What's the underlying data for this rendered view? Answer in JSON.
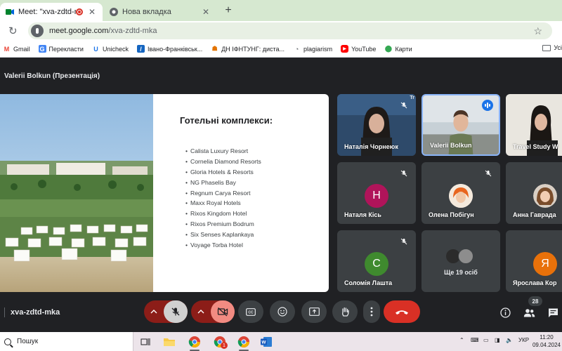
{
  "browser": {
    "tabs": [
      {
        "title": "Meet: \"xva-zdtd-mka\"",
        "active": true
      },
      {
        "title": "Нова вкладка",
        "active": false
      }
    ],
    "url_host": "meet.google.com",
    "url_path": "/xva-zdtd-mka",
    "bookmarks": [
      {
        "label": "Gmail",
        "icon": "gmail-icon"
      },
      {
        "label": "Перекласти",
        "icon": "translate-icon"
      },
      {
        "label": "Unicheck",
        "icon": "unicheck-icon"
      },
      {
        "label": "Івано-Франківськ...",
        "icon": "bookmark-site-icon"
      },
      {
        "label": "ДН ІФНТУНГ: диста...",
        "icon": "bookmark-site-icon"
      },
      {
        "label": "plagiarism",
        "icon": "plagiarism-icon"
      },
      {
        "label": "YouTube",
        "icon": "youtube-icon"
      },
      {
        "label": "Карти",
        "icon": "maps-icon"
      }
    ],
    "other_bookmarks_label": "Усі"
  },
  "meet": {
    "presenter_title": "Valerii Bolkun (Презентація)",
    "slide": {
      "title": "Готельні комплекси:",
      "hotels": [
        "Calista Luxury Resort",
        "Cornelia Diamond Resorts",
        "Gloria Hotels & Resorts",
        "NG Phaselis Bay",
        "Regnum Carya Resort",
        "Maxx Royal Hotels",
        "Rixos Kingdom Hotel",
        "Rixos Premium Bodrum",
        "Six Senses Kaplankaya",
        "Voyage Torba Hotel"
      ]
    },
    "participants": [
      {
        "name": "Наталія Чорнеюк",
        "type": "video",
        "muted": true
      },
      {
        "name": "Valerii Bolkun",
        "type": "video",
        "speaking": true
      },
      {
        "name": "Travel Study W",
        "type": "video",
        "muted": false
      },
      {
        "name": "Наталя Кісь",
        "type": "avatar",
        "initial": "Н",
        "color": "#b0145a",
        "muted": true
      },
      {
        "name": "Олена Побігун",
        "type": "photo",
        "muted": true
      },
      {
        "name": "Анна Гаврада",
        "type": "photo",
        "muted": false
      },
      {
        "name": "Соломія Лашта",
        "type": "avatar",
        "initial": "С",
        "color": "#3f8a2e",
        "muted": true
      },
      {
        "name": "Ще 19 осіб",
        "type": "more"
      },
      {
        "name": "Ярослава Кор",
        "type": "avatar",
        "initial": "Я",
        "color": "#e8710a",
        "muted": false
      }
    ],
    "tile_corner_label": "Tr",
    "meeting_code": "xva-zdtd-mka",
    "people_count": "28"
  },
  "taskbar": {
    "search_placeholder": "Пошук",
    "language": "УКР",
    "time": "11:20",
    "date": "09.04.2024",
    "notification_badge": "1"
  },
  "colors": {
    "meet_bg": "#202124",
    "tile_bg": "#3c4043",
    "end_call": "#d93025",
    "mic_off_bg": "#8c1d18",
    "speaking_border": "#8ab4f8"
  }
}
